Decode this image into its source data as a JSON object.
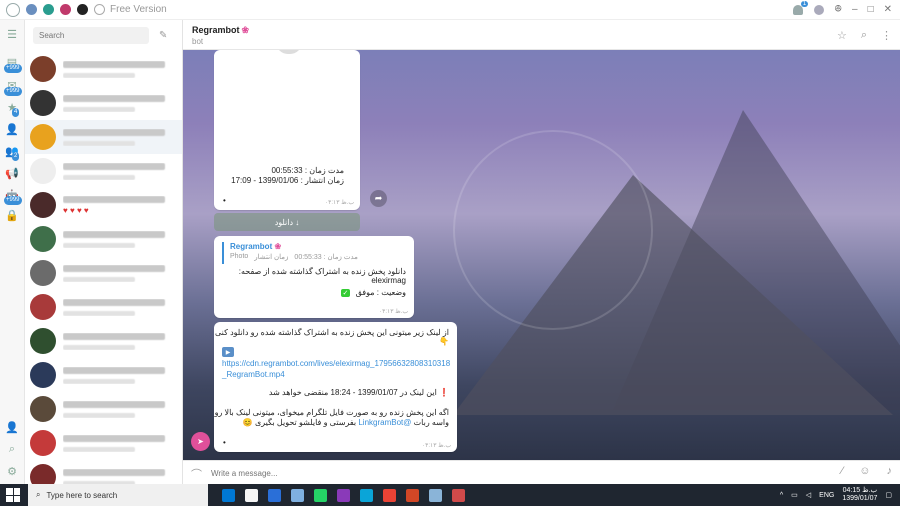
{
  "window": {
    "version_label": "Free Version",
    "accent_dots": [
      "#6a8fbf",
      "#2a9d8f",
      "#c0396b",
      "#222222"
    ],
    "notification_badge": "1",
    "controls": {
      "minimize": "–",
      "maximize": "□",
      "close": "✕"
    }
  },
  "rail": {
    "badges": [
      "+999",
      "+999",
      "4",
      "2",
      "+999"
    ]
  },
  "sidebar": {
    "search_placeholder": "Search",
    "chats": [
      {
        "color": "#7b3e2a"
      },
      {
        "color": "#333333"
      },
      {
        "color": "#e8a21e"
      },
      {
        "color": "#eeeeee"
      },
      {
        "color": "#4a2a2a",
        "hearts": "♥ ♥ ♥ ♥"
      },
      {
        "color": "#3f6f4a"
      },
      {
        "color": "#6b6b6b"
      },
      {
        "color": "#a83a3a"
      },
      {
        "color": "#2f4f2f"
      },
      {
        "color": "#2b3a5a"
      },
      {
        "color": "#5a4a3a"
      },
      {
        "color": "#c43a3a"
      },
      {
        "color": "#7a2a2a"
      }
    ]
  },
  "header": {
    "title": "Regrambot",
    "subtitle": "bot"
  },
  "messages": {
    "m1": {
      "duration": "مدت زمان : 00:55:33",
      "published": "زمان انتشار : 1399/01/06 - 17:09",
      "time": "۰۴:۱۳ ب.ظ",
      "dot": "•"
    },
    "download_button": "دانلود ↓",
    "m2": {
      "quote_title": "Regrambot",
      "quote_meta_1": "Photo",
      "quote_meta_2": "زمان انتشار",
      "quote_meta_3": "مدت زمان : 00:55:33",
      "line1": "دانلود پخش زنده به اشتراک گذاشته شده از صفحه: elexirmag",
      "status": "وضعیت : موفق",
      "tick": "✓",
      "time": "۰۴:۱۳ ب.ظ"
    },
    "m3": {
      "intro": "از لینک زیر میتونی این پخش زنده به اشتراک گذاشته شده رو دانلود کنی 👇",
      "link": "https://cdn.regrambot.com/lives/elexirmag_17956632808310318_RegramBot.mp4",
      "expire_prefix": "❗",
      "expire": "این لینک در 1399/01/07 - 18:24 منقضی خواهد شد",
      "tip1": "اگه این پخش زنده رو به صورت فایل تلگرام میخوای، میتونی لینک بالا رو",
      "tip2_pre": "واسه ربات",
      "mention": "@LinkgramBot",
      "tip2_post": "بفرستی و فایلشو تحویل بگیری 😊",
      "time": "۰۴:۱۳ ب.ظ",
      "dot": "•"
    }
  },
  "compose": {
    "placeholder": "Write a message..."
  },
  "taskbar": {
    "search_placeholder": "Type here to search",
    "language": "ENG",
    "time": "04:15 ب.ظ",
    "date": "1399/01/07",
    "app_colors": [
      "#0078d4",
      "#f5f5f5",
      "#2a6fd8",
      "#7fb0e0",
      "#25d366",
      "#8a3ab9",
      "#0aa5d8",
      "#ea4335",
      "#d24726",
      "#8ab4d8",
      "#d04a4a"
    ]
  }
}
